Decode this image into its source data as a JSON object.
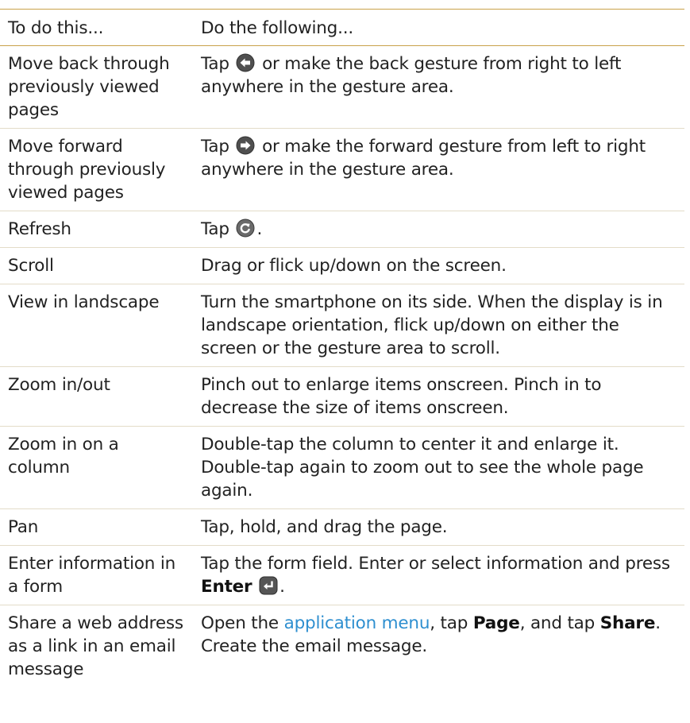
{
  "header": {
    "col1": "To do this...",
    "col2": "Do the following..."
  },
  "rows": [
    {
      "action": "Move back through previously viewed pages",
      "instr_before": "Tap",
      "icon": "back-arrow-icon",
      "instr_after": "or make the back gesture from right to left anywhere in the gesture area."
    },
    {
      "action": "Move forward through previously viewed pages",
      "instr_before": "Tap",
      "icon": "forward-arrow-icon",
      "instr_after": "or make the forward gesture from left to right anywhere in the gesture area."
    },
    {
      "action": "Refresh",
      "instr_before": "Tap",
      "icon": "refresh-icon",
      "instr_after": "."
    },
    {
      "action": "Scroll",
      "instr": "Drag or flick up/down on the screen."
    },
    {
      "action": "View in landscape",
      "instr": "Turn the smartphone on its side. When the display is in landscape orientation, flick up/down on either the screen or the gesture area to scroll."
    },
    {
      "action": "Zoom in/out",
      "instr": "Pinch out to enlarge items onscreen. Pinch in to decrease the size of items onscreen."
    },
    {
      "action": "Zoom in on a column",
      "instr": "Double-tap the column to center it and enlarge it. Double-tap again to zoom out to see the whole page again."
    },
    {
      "action": "Pan",
      "instr": "Tap, hold, and drag the page."
    },
    {
      "action": "Enter information in a form",
      "instr_before": "Tap the form field. Enter or select information and press",
      "key": "Enter",
      "icon": "enter-key-icon",
      "instr_after": "."
    },
    {
      "action": "Share a web address as a link in an email message",
      "instr_p1": "Open the",
      "link": "application menu",
      "instr_p2": ", tap",
      "key1": "Page",
      "instr_p3": ", and tap",
      "key2": "Share",
      "instr_p4": ". Create the email message."
    }
  ],
  "colors": {
    "rule": "#c9a24a",
    "link": "#2e8fd0",
    "icon_fill": "#555555"
  }
}
